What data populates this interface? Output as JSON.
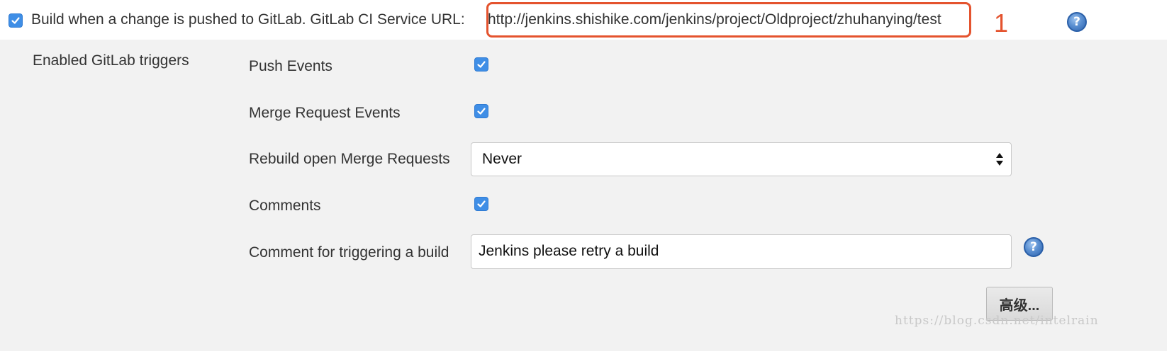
{
  "trigger": {
    "build_label": "Build when a change is pushed to GitLab. GitLab CI Service URL:",
    "service_url": "http://jenkins.shishike.com/jenkins/project/Oldproject/zhuhanying/test",
    "checked": true,
    "annotation_number": "1"
  },
  "section": {
    "label": "Enabled GitLab triggers"
  },
  "options": {
    "push_events": {
      "label": "Push Events",
      "checked": true
    },
    "merge_request_events": {
      "label": "Merge Request Events",
      "checked": true
    },
    "rebuild_mr": {
      "label": "Rebuild open Merge Requests",
      "value": "Never"
    },
    "comments": {
      "label": "Comments",
      "checked": true
    },
    "comment_trigger": {
      "label": "Comment for triggering a build",
      "value": "Jenkins please retry a build"
    }
  },
  "buttons": {
    "advanced": "高级..."
  },
  "help_icon_text": "?",
  "watermark": "https://blog.csdn.net/intelrain",
  "colors": {
    "panel_bg": "#f2f2f2",
    "checkbox_blue": "#3f8ee6",
    "annotation_red": "#e4532e",
    "help_blue": "#2d62ad"
  }
}
